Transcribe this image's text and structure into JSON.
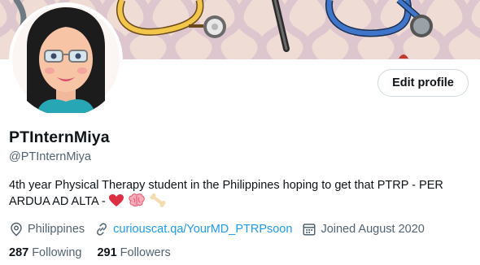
{
  "profile": {
    "display_name": "PTInternMiya",
    "handle": "@PTInternMiya",
    "bio_text": "4th year Physical Therapy student in the Philippines hoping to get that PTRP - PER ARDUA AD ALTA -",
    "bio_emojis": [
      "red-heart",
      "brain",
      "bone"
    ],
    "edit_profile_label": "Edit profile",
    "location": "Philippines",
    "link": "curiouscat.qa/YourMD_PTRPsoon",
    "joined": "Joined August 2020",
    "following_count": "287",
    "following_label": "Following",
    "followers_count": "291",
    "followers_label": "Followers"
  },
  "colors": {
    "text_primary": "#0f1419",
    "text_secondary": "#536471",
    "link": "#1d9bf0",
    "button_border": "#cfd9de",
    "banner_bg": "#ecd9d0"
  },
  "icons": [
    "location-pin-icon",
    "link-icon",
    "calendar-icon"
  ]
}
